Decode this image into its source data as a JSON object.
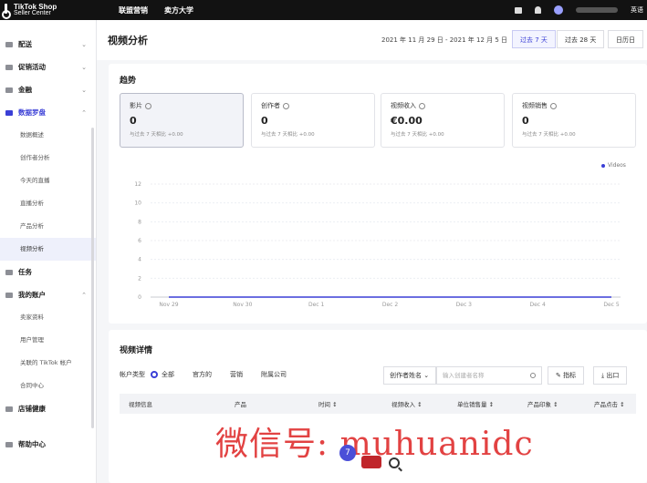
{
  "brand": {
    "line1": "TikTok Shop",
    "line2": "Seller Center"
  },
  "topnav": [
    "联盟营销",
    "卖方大学"
  ],
  "topbar": {
    "language": "英语"
  },
  "sidebar": {
    "items": [
      {
        "label": "配送",
        "icon": "truck-icon"
      },
      {
        "label": "促销活动",
        "icon": "megaphone-icon"
      },
      {
        "label": "金融",
        "icon": "wallet-icon"
      },
      {
        "label": "数据罗盘",
        "icon": "chart-icon"
      }
    ],
    "subitems": [
      "数据概述",
      "创作者分析",
      "今天的直播",
      "直播分析",
      "产品分析",
      "视频分析"
    ],
    "items2": [
      {
        "label": "任务",
        "icon": "task-icon"
      },
      {
        "label": "我的账户",
        "icon": "user-icon"
      }
    ],
    "subitems2": [
      "卖家资料",
      "用户管理",
      "关联的 TikTok 帐户",
      "合同中心"
    ],
    "items3": [
      {
        "label": "店铺健康",
        "icon": "shield-icon"
      },
      {
        "label": "帮助中心",
        "icon": "help-icon"
      }
    ]
  },
  "header": {
    "title": "视频分析",
    "date_range": "2021 年 11 月 29 日 - 2021 年 12 月 5 日",
    "ranges": [
      "过去 7 天",
      "过去 28 天",
      "日历日"
    ]
  },
  "trend": {
    "title": "趋势",
    "metrics": [
      {
        "label": "影片",
        "value": "0",
        "compare": "与过去 7 天相比 +0.00"
      },
      {
        "label": "创作者",
        "value": "0",
        "compare": "与过去 7 天相比 +0.00"
      },
      {
        "label": "视频收入",
        "value": "€0.00",
        "compare": "与过去 7 天相比 +0.00"
      },
      {
        "label": "视频销售",
        "value": "0",
        "compare": "与过去 7 天相比 +0.00"
      }
    ],
    "legend": "Videos"
  },
  "chart_data": {
    "type": "line",
    "categories": [
      "Nov 29",
      "Nov 30",
      "Dec 1",
      "Dec 2",
      "Dec 3",
      "Dec 4",
      "Dec 5"
    ],
    "series": [
      {
        "name": "Videos",
        "values": [
          0,
          0,
          0,
          0,
          0,
          0,
          0
        ]
      }
    ],
    "yticks": [
      0,
      2,
      4,
      6,
      8,
      10,
      12
    ],
    "ylim": [
      0,
      12
    ],
    "grid": true,
    "legend_position": "top-right",
    "colors": {
      "line": "#3a3fd6"
    }
  },
  "details": {
    "title": "视频详情",
    "filter_label": "帐户类型",
    "options": [
      "全部",
      "官方的",
      "营销",
      "附属公司"
    ],
    "select_label": "创作者姓名",
    "search_placeholder": "输入创建者名称",
    "configure_label": "指标",
    "export_label": "出口",
    "columns": [
      "视频信息",
      "产品",
      "时间 ↕",
      "视频收入 ↕",
      "单位销售量 ↕",
      "产品印象 ↕",
      "产品点击 ↕"
    ]
  },
  "watermark": "微信号: muhuanidc",
  "badge_count": "7"
}
